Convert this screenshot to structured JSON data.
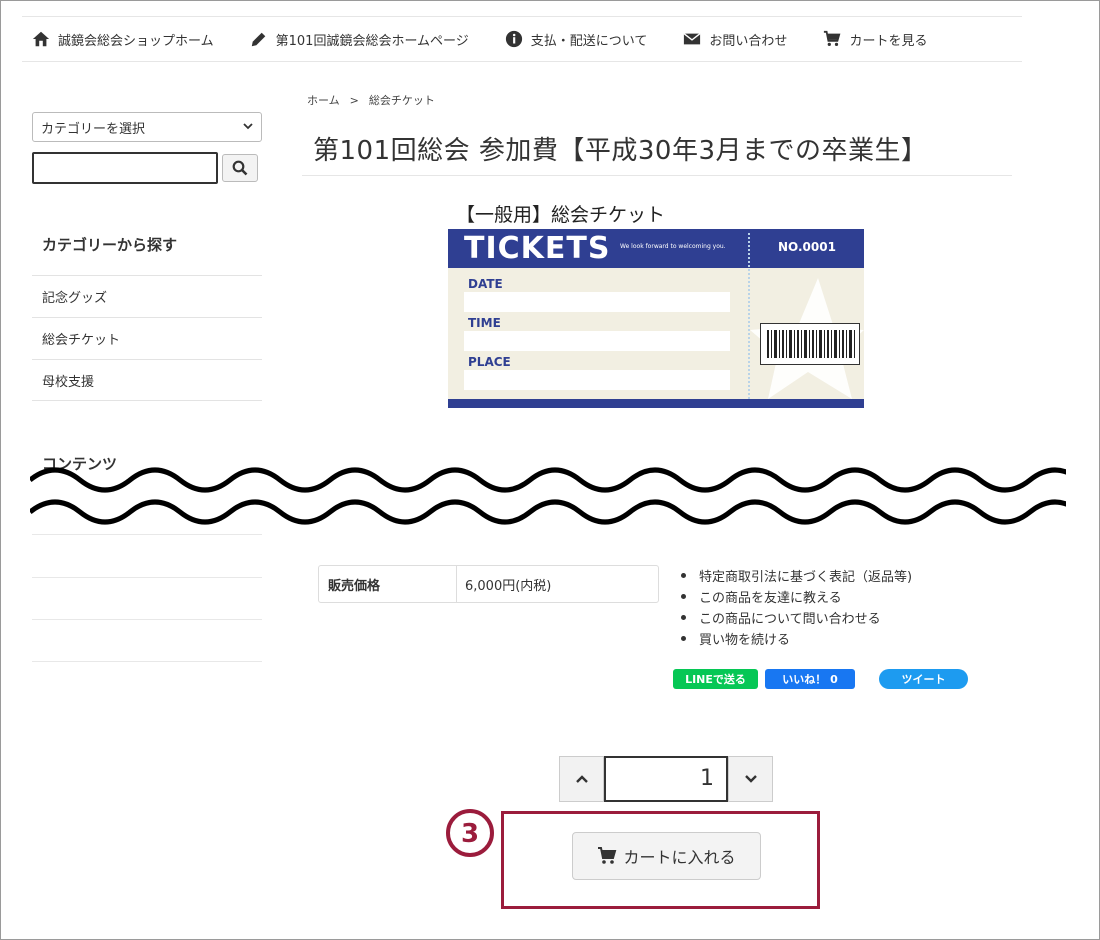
{
  "nav": [
    {
      "label": "誠鏡会総会ショップホーム",
      "icon": "home-icon"
    },
    {
      "label": "第101回誠鏡会総会ホームページ",
      "icon": "pencil-icon"
    },
    {
      "label": "支払・配送について",
      "icon": "info-icon"
    },
    {
      "label": "お問い合わせ",
      "icon": "mail-icon"
    },
    {
      "label": "カートを見る",
      "icon": "cart-icon"
    }
  ],
  "sidebar": {
    "category_select": "カテゴリーを選択",
    "search_value": "",
    "category_heading": "カテゴリーから探す",
    "categories": [
      "記念グッズ",
      "総会チケット",
      "母校支援"
    ],
    "contents_heading": "コンテンツ"
  },
  "breadcrumb": [
    "ホーム",
    ">",
    "総会チケット"
  ],
  "product": {
    "title": "第101回総会 参加費【平成30年3月までの卒業生】",
    "image_caption": "【一般用】総会チケット",
    "ticket": {
      "heading": "TICKETS",
      "tagline": "We look forward to welcoming you.",
      "number": "NO.0001",
      "fields": [
        "DATE",
        "TIME",
        "PLACE"
      ]
    },
    "price_label": "販売価格",
    "price_value": "6,000円(内税)",
    "links": [
      "特定商取引法に基づく表記（返品等)",
      "この商品を友達に教える",
      "この商品について問い合わせる",
      "買い物を続ける"
    ],
    "social": {
      "line": "LINEで送る",
      "like": "いいね！ 0",
      "tweet": "ツイート"
    },
    "quantity": "1",
    "cart_button": "カートに入れる"
  },
  "annotation_number": "3",
  "colors": {
    "ticket_blue": "#2f3f92",
    "marker": "#9b1c3c",
    "line_green": "#06c755",
    "fb_blue": "#1877f2",
    "tw_blue": "#1d9bf0"
  }
}
